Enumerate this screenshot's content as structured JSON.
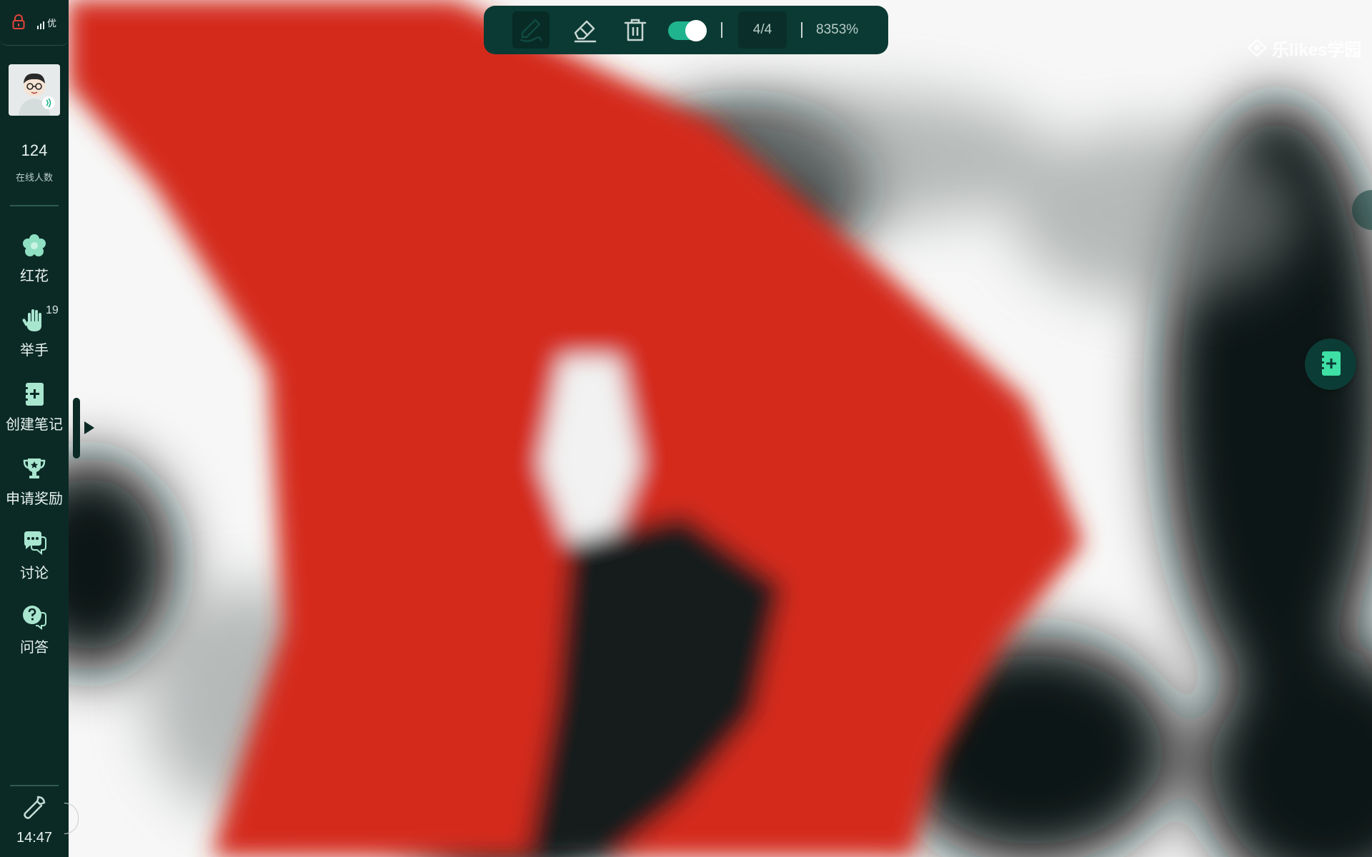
{
  "status": {
    "network_quality": "优"
  },
  "user": {
    "online_count": "124",
    "online_label": "在线人数"
  },
  "sidebar": {
    "items": [
      {
        "label": "红花",
        "icon": "flower-icon"
      },
      {
        "label": "举手",
        "icon": "raise-hand-icon",
        "badge": "19"
      },
      {
        "label": "创建笔记",
        "icon": "notebook-add-icon"
      },
      {
        "label": "申请奖励",
        "icon": "trophy-icon"
      },
      {
        "label": "讨论",
        "icon": "discussion-icon"
      },
      {
        "label": "问答",
        "icon": "qa-icon"
      }
    ],
    "time": "14:47"
  },
  "toolbar": {
    "tools": [
      "pen-icon",
      "eraser-icon",
      "trash-icon"
    ],
    "toggle_on": true,
    "page": "4/4",
    "zoom": "8353%"
  },
  "watermark": {
    "text": "乐likes学园"
  },
  "colors": {
    "sidebar_bg": "#0b2a26",
    "toolbar_bg": "#0b3a34",
    "accent": "#1fb48e",
    "content_red": "#d42a1c"
  }
}
